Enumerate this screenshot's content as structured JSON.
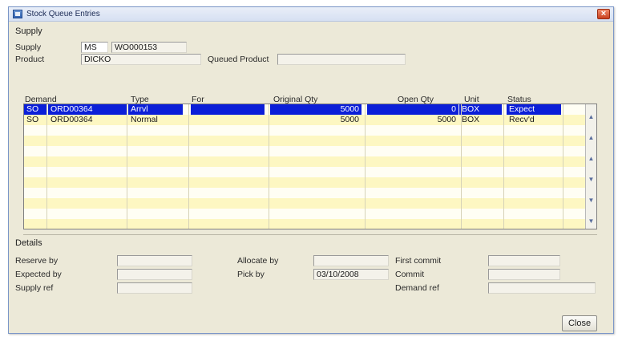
{
  "window": {
    "title": "Stock Queue Entries",
    "close_glyph": "×"
  },
  "supply_section": {
    "heading": "Supply",
    "supply_label": "Supply",
    "supply_type": "MS",
    "supply_ref": "WO000153",
    "product_label": "Product",
    "product_value": "DICKO",
    "queued_product_label": "Queued Product",
    "queued_product_value": ""
  },
  "table": {
    "columns": [
      "Demand",
      "Type",
      "For",
      "Original Qty",
      "Open Qty",
      "Unit",
      "Status"
    ],
    "rows": [
      {
        "demand_type": "SO",
        "demand": "ORD00364",
        "type": "Arrvl",
        "for": "",
        "original_qty": "5000",
        "open_qty": "0",
        "unit": "BOX",
        "status": "Expect"
      },
      {
        "demand_type": "SO",
        "demand": "ORD00364",
        "type": "Normal",
        "for": "",
        "original_qty": "5000",
        "open_qty": "5000",
        "unit": "BOX",
        "status": "Recv'd"
      }
    ]
  },
  "details": {
    "heading": "Details",
    "reserve_by_label": "Reserve by",
    "reserve_by": "",
    "expected_by_label": "Expected by",
    "expected_by": "",
    "supply_ref_label": "Supply ref",
    "supply_ref": "",
    "allocate_by_label": "Allocate by",
    "allocate_by": "",
    "pick_by_label": "Pick by",
    "pick_by": "03/10/2008",
    "first_commit_label": "First commit",
    "first_commit": "",
    "commit_label": "Commit",
    "commit": "",
    "demand_ref_label": "Demand ref",
    "demand_ref": ""
  },
  "buttons": {
    "close": "Close"
  },
  "colors": {
    "selection": "#0b1fd8",
    "row_alt": "#fdf7c2",
    "window_bg": "#ece9d8"
  }
}
